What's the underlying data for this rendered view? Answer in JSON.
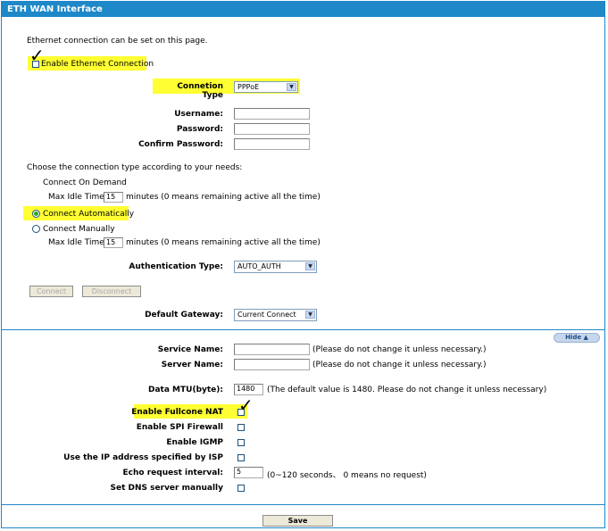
{
  "window": {
    "title": "ETH WAN Interface"
  },
  "intro": "Ethernet connection can be set on this page.",
  "enable_ethernet": {
    "label": "Enable Ethernet Connection",
    "checked": true
  },
  "connection_type": {
    "label": "Connetion Type",
    "value": "PPPoE"
  },
  "credentials": {
    "username_label": "Username:",
    "password_label": "Password:",
    "confirm_label": "Confirm Password:",
    "username": "",
    "password": "",
    "confirm": ""
  },
  "mode": {
    "prompt": "Choose the connection type according to your needs:",
    "on_demand": "Connect On Demand",
    "max_idle_label": "Max Idle Time:",
    "max_idle_1": "15",
    "minutes_note": "minutes (0 means remaining active all the time)",
    "automatic": "Connect Automatically",
    "manual": "Connect Manually",
    "max_idle_2": "15",
    "selected": "automatic"
  },
  "auth": {
    "label": "Authentication Type:",
    "value": "AUTO_AUTH"
  },
  "buttons": {
    "connect": "Connect",
    "disconnect": "Disconnect",
    "save": "Save",
    "hide": "Hide"
  },
  "gateway": {
    "label": "Default Gateway:",
    "value": "Current Connect"
  },
  "advanced": {
    "service_name_label": "Service Name:",
    "server_name_label": "Server Name:",
    "service_name": "",
    "server_name": "",
    "unchanged_note_1": "(Please do not change it unless necessary.)",
    "unchanged_note_2": "(Please do not change it unless necessary.)",
    "mtu_label": "Data MTU(byte):",
    "mtu_value": "1480",
    "mtu_note": "(The default value is 1480. Please do not change it unless necessary)",
    "fullcone_label": "Enable Fullcone NAT",
    "spi_label": "Enable SPI Firewall",
    "igmp_label": "Enable IGMP",
    "isp_ip_label": "Use the IP address specified by ISP",
    "echo_label": "Echo request interval:",
    "echo_value": "5",
    "echo_note": "(0~120 seconds、 0 means no request)",
    "dns_label": "Set DNS server manually"
  }
}
